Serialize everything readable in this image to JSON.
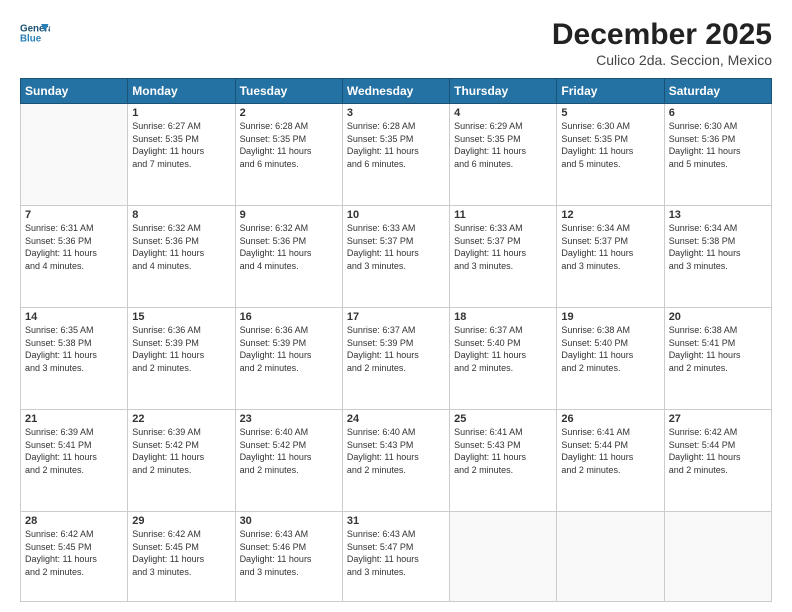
{
  "header": {
    "logo_line1": "General",
    "logo_line2": "Blue",
    "month": "December 2025",
    "location": "Culico 2da. Seccion, Mexico"
  },
  "weekdays": [
    "Sunday",
    "Monday",
    "Tuesday",
    "Wednesday",
    "Thursday",
    "Friday",
    "Saturday"
  ],
  "weeks": [
    [
      {
        "day": "",
        "info": ""
      },
      {
        "day": "1",
        "info": "Sunrise: 6:27 AM\nSunset: 5:35 PM\nDaylight: 11 hours\nand 7 minutes."
      },
      {
        "day": "2",
        "info": "Sunrise: 6:28 AM\nSunset: 5:35 PM\nDaylight: 11 hours\nand 6 minutes."
      },
      {
        "day": "3",
        "info": "Sunrise: 6:28 AM\nSunset: 5:35 PM\nDaylight: 11 hours\nand 6 minutes."
      },
      {
        "day": "4",
        "info": "Sunrise: 6:29 AM\nSunset: 5:35 PM\nDaylight: 11 hours\nand 6 minutes."
      },
      {
        "day": "5",
        "info": "Sunrise: 6:30 AM\nSunset: 5:35 PM\nDaylight: 11 hours\nand 5 minutes."
      },
      {
        "day": "6",
        "info": "Sunrise: 6:30 AM\nSunset: 5:36 PM\nDaylight: 11 hours\nand 5 minutes."
      }
    ],
    [
      {
        "day": "7",
        "info": "Sunrise: 6:31 AM\nSunset: 5:36 PM\nDaylight: 11 hours\nand 4 minutes."
      },
      {
        "day": "8",
        "info": "Sunrise: 6:32 AM\nSunset: 5:36 PM\nDaylight: 11 hours\nand 4 minutes."
      },
      {
        "day": "9",
        "info": "Sunrise: 6:32 AM\nSunset: 5:36 PM\nDaylight: 11 hours\nand 4 minutes."
      },
      {
        "day": "10",
        "info": "Sunrise: 6:33 AM\nSunset: 5:37 PM\nDaylight: 11 hours\nand 3 minutes."
      },
      {
        "day": "11",
        "info": "Sunrise: 6:33 AM\nSunset: 5:37 PM\nDaylight: 11 hours\nand 3 minutes."
      },
      {
        "day": "12",
        "info": "Sunrise: 6:34 AM\nSunset: 5:37 PM\nDaylight: 11 hours\nand 3 minutes."
      },
      {
        "day": "13",
        "info": "Sunrise: 6:34 AM\nSunset: 5:38 PM\nDaylight: 11 hours\nand 3 minutes."
      }
    ],
    [
      {
        "day": "14",
        "info": "Sunrise: 6:35 AM\nSunset: 5:38 PM\nDaylight: 11 hours\nand 3 minutes."
      },
      {
        "day": "15",
        "info": "Sunrise: 6:36 AM\nSunset: 5:39 PM\nDaylight: 11 hours\nand 2 minutes."
      },
      {
        "day": "16",
        "info": "Sunrise: 6:36 AM\nSunset: 5:39 PM\nDaylight: 11 hours\nand 2 minutes."
      },
      {
        "day": "17",
        "info": "Sunrise: 6:37 AM\nSunset: 5:39 PM\nDaylight: 11 hours\nand 2 minutes."
      },
      {
        "day": "18",
        "info": "Sunrise: 6:37 AM\nSunset: 5:40 PM\nDaylight: 11 hours\nand 2 minutes."
      },
      {
        "day": "19",
        "info": "Sunrise: 6:38 AM\nSunset: 5:40 PM\nDaylight: 11 hours\nand 2 minutes."
      },
      {
        "day": "20",
        "info": "Sunrise: 6:38 AM\nSunset: 5:41 PM\nDaylight: 11 hours\nand 2 minutes."
      }
    ],
    [
      {
        "day": "21",
        "info": "Sunrise: 6:39 AM\nSunset: 5:41 PM\nDaylight: 11 hours\nand 2 minutes."
      },
      {
        "day": "22",
        "info": "Sunrise: 6:39 AM\nSunset: 5:42 PM\nDaylight: 11 hours\nand 2 minutes."
      },
      {
        "day": "23",
        "info": "Sunrise: 6:40 AM\nSunset: 5:42 PM\nDaylight: 11 hours\nand 2 minutes."
      },
      {
        "day": "24",
        "info": "Sunrise: 6:40 AM\nSunset: 5:43 PM\nDaylight: 11 hours\nand 2 minutes."
      },
      {
        "day": "25",
        "info": "Sunrise: 6:41 AM\nSunset: 5:43 PM\nDaylight: 11 hours\nand 2 minutes."
      },
      {
        "day": "26",
        "info": "Sunrise: 6:41 AM\nSunset: 5:44 PM\nDaylight: 11 hours\nand 2 minutes."
      },
      {
        "day": "27",
        "info": "Sunrise: 6:42 AM\nSunset: 5:44 PM\nDaylight: 11 hours\nand 2 minutes."
      }
    ],
    [
      {
        "day": "28",
        "info": "Sunrise: 6:42 AM\nSunset: 5:45 PM\nDaylight: 11 hours\nand 2 minutes."
      },
      {
        "day": "29",
        "info": "Sunrise: 6:42 AM\nSunset: 5:45 PM\nDaylight: 11 hours\nand 3 minutes."
      },
      {
        "day": "30",
        "info": "Sunrise: 6:43 AM\nSunset: 5:46 PM\nDaylight: 11 hours\nand 3 minutes."
      },
      {
        "day": "31",
        "info": "Sunrise: 6:43 AM\nSunset: 5:47 PM\nDaylight: 11 hours\nand 3 minutes."
      },
      {
        "day": "",
        "info": ""
      },
      {
        "day": "",
        "info": ""
      },
      {
        "day": "",
        "info": ""
      }
    ]
  ]
}
